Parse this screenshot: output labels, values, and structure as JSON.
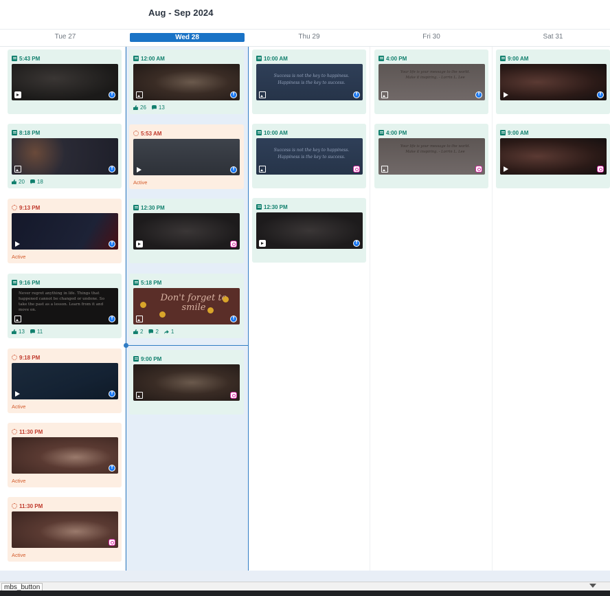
{
  "range_title": "Aug - Sep 2024",
  "days": [
    {
      "label": "Tue 27",
      "today": false
    },
    {
      "label": "Wed 28",
      "today": true
    },
    {
      "label": "Thu 29",
      "today": false
    },
    {
      "label": "Fri 30",
      "today": false
    },
    {
      "label": "Sat 31",
      "today": false
    }
  ],
  "posts": {
    "tue": [
      {
        "time": "5:43 PM",
        "status": "published",
        "media": "reel",
        "network": "facebook"
      },
      {
        "time": "8:18 PM",
        "status": "published",
        "media": "image",
        "network": "facebook",
        "likes": "20",
        "comments": "18"
      },
      {
        "time": "9:13 PM",
        "status": "active",
        "media": "video",
        "network": "facebook",
        "active_label": "Active"
      },
      {
        "time": "9:16 PM",
        "status": "published",
        "media": "image",
        "network": "facebook",
        "likes": "13",
        "comments": "11",
        "quote": "Never regret anything in life. Things that happened cannot be changed or undone. So take the past as a lesson. Learn from it and move on."
      },
      {
        "time": "9:18 PM",
        "status": "active",
        "media": "video",
        "network": "facebook",
        "active_label": "Active"
      },
      {
        "time": "11:30 PM",
        "status": "active",
        "media": "none",
        "network": "facebook",
        "active_label": "Active"
      },
      {
        "time": "11:30 PM",
        "status": "active",
        "media": "none",
        "network": "instagram",
        "active_label": "Active"
      }
    ],
    "wed": [
      {
        "time": "12:00 AM",
        "status": "published",
        "media": "image",
        "network": "facebook",
        "likes": "26",
        "comments": "13"
      },
      {
        "time": "5:53 AM",
        "status": "active",
        "media": "video",
        "network": "facebook",
        "active_label": "Active"
      },
      {
        "time": "12:30 PM",
        "status": "published",
        "media": "reel",
        "network": "instagram"
      },
      {
        "time": "5:18 PM",
        "status": "published",
        "media": "image",
        "network": "facebook",
        "likes": "2",
        "comments": "2",
        "shares": "1",
        "quote": "Don't forget to smile"
      },
      {
        "time": "9:00 PM",
        "status": "published",
        "media": "image",
        "network": "instagram"
      }
    ],
    "thu": [
      {
        "time": "10:00 AM",
        "status": "published",
        "media": "image",
        "network": "facebook",
        "quote": "Success is not the key to happiness. Happiness is the key to success."
      },
      {
        "time": "10:00 AM",
        "status": "published",
        "media": "image",
        "network": "instagram",
        "quote": "Success is not the key to happiness. Happiness is the key to success."
      },
      {
        "time": "12:30 PM",
        "status": "published",
        "media": "reel",
        "network": "facebook"
      }
    ],
    "fri": [
      {
        "time": "4:00 PM",
        "status": "published",
        "media": "image",
        "network": "facebook",
        "quote": "Your life is your message to the world. Make it inspiring. - Lorrin L. Lee"
      },
      {
        "time": "4:00 PM",
        "status": "published",
        "media": "image",
        "network": "instagram",
        "quote": "Your life is your message to the world. Make it inspiring. - Lorrin L. Lee"
      }
    ],
    "sat": [
      {
        "time": "9:00 AM",
        "status": "published",
        "media": "video",
        "network": "facebook"
      },
      {
        "time": "9:00 AM",
        "status": "published",
        "media": "video",
        "network": "instagram"
      }
    ]
  },
  "devtools_label": "mbs_button",
  "colors": {
    "accent": "#1a73c6",
    "published": "#12806e",
    "active": "#c0392b",
    "published_bg": "#e4f3ee",
    "active_bg": "#fdeee2",
    "today_bg": "#e5eef8"
  }
}
